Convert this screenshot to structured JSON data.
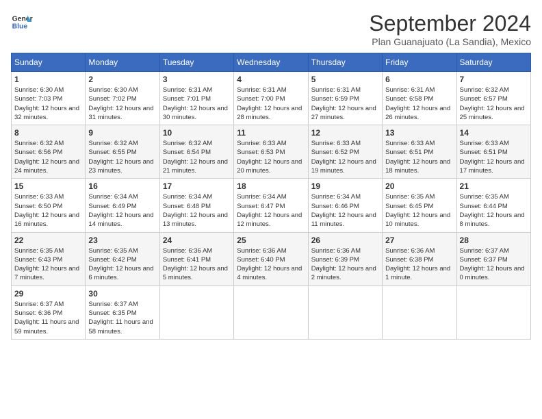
{
  "logo": {
    "line1": "General",
    "line2": "Blue"
  },
  "title": "September 2024",
  "location": "Plan Guanajuato (La Sandia), Mexico",
  "days_of_week": [
    "Sunday",
    "Monday",
    "Tuesday",
    "Wednesday",
    "Thursday",
    "Friday",
    "Saturday"
  ],
  "weeks": [
    [
      {
        "day": "1",
        "sunrise": "6:30 AM",
        "sunset": "7:03 PM",
        "daylight": "12 hours and 32 minutes."
      },
      {
        "day": "2",
        "sunrise": "6:30 AM",
        "sunset": "7:02 PM",
        "daylight": "12 hours and 31 minutes."
      },
      {
        "day": "3",
        "sunrise": "6:31 AM",
        "sunset": "7:01 PM",
        "daylight": "12 hours and 30 minutes."
      },
      {
        "day": "4",
        "sunrise": "6:31 AM",
        "sunset": "7:00 PM",
        "daylight": "12 hours and 28 minutes."
      },
      {
        "day": "5",
        "sunrise": "6:31 AM",
        "sunset": "6:59 PM",
        "daylight": "12 hours and 27 minutes."
      },
      {
        "day": "6",
        "sunrise": "6:31 AM",
        "sunset": "6:58 PM",
        "daylight": "12 hours and 26 minutes."
      },
      {
        "day": "7",
        "sunrise": "6:32 AM",
        "sunset": "6:57 PM",
        "daylight": "12 hours and 25 minutes."
      }
    ],
    [
      {
        "day": "8",
        "sunrise": "6:32 AM",
        "sunset": "6:56 PM",
        "daylight": "12 hours and 24 minutes."
      },
      {
        "day": "9",
        "sunrise": "6:32 AM",
        "sunset": "6:55 PM",
        "daylight": "12 hours and 23 minutes."
      },
      {
        "day": "10",
        "sunrise": "6:32 AM",
        "sunset": "6:54 PM",
        "daylight": "12 hours and 21 minutes."
      },
      {
        "day": "11",
        "sunrise": "6:33 AM",
        "sunset": "6:53 PM",
        "daylight": "12 hours and 20 minutes."
      },
      {
        "day": "12",
        "sunrise": "6:33 AM",
        "sunset": "6:52 PM",
        "daylight": "12 hours and 19 minutes."
      },
      {
        "day": "13",
        "sunrise": "6:33 AM",
        "sunset": "6:51 PM",
        "daylight": "12 hours and 18 minutes."
      },
      {
        "day": "14",
        "sunrise": "6:33 AM",
        "sunset": "6:51 PM",
        "daylight": "12 hours and 17 minutes."
      }
    ],
    [
      {
        "day": "15",
        "sunrise": "6:33 AM",
        "sunset": "6:50 PM",
        "daylight": "12 hours and 16 minutes."
      },
      {
        "day": "16",
        "sunrise": "6:34 AM",
        "sunset": "6:49 PM",
        "daylight": "12 hours and 14 minutes."
      },
      {
        "day": "17",
        "sunrise": "6:34 AM",
        "sunset": "6:48 PM",
        "daylight": "12 hours and 13 minutes."
      },
      {
        "day": "18",
        "sunrise": "6:34 AM",
        "sunset": "6:47 PM",
        "daylight": "12 hours and 12 minutes."
      },
      {
        "day": "19",
        "sunrise": "6:34 AM",
        "sunset": "6:46 PM",
        "daylight": "12 hours and 11 minutes."
      },
      {
        "day": "20",
        "sunrise": "6:35 AM",
        "sunset": "6:45 PM",
        "daylight": "12 hours and 10 minutes."
      },
      {
        "day": "21",
        "sunrise": "6:35 AM",
        "sunset": "6:44 PM",
        "daylight": "12 hours and 8 minutes."
      }
    ],
    [
      {
        "day": "22",
        "sunrise": "6:35 AM",
        "sunset": "6:43 PM",
        "daylight": "12 hours and 7 minutes."
      },
      {
        "day": "23",
        "sunrise": "6:35 AM",
        "sunset": "6:42 PM",
        "daylight": "12 hours and 6 minutes."
      },
      {
        "day": "24",
        "sunrise": "6:36 AM",
        "sunset": "6:41 PM",
        "daylight": "12 hours and 5 minutes."
      },
      {
        "day": "25",
        "sunrise": "6:36 AM",
        "sunset": "6:40 PM",
        "daylight": "12 hours and 4 minutes."
      },
      {
        "day": "26",
        "sunrise": "6:36 AM",
        "sunset": "6:39 PM",
        "daylight": "12 hours and 2 minutes."
      },
      {
        "day": "27",
        "sunrise": "6:36 AM",
        "sunset": "6:38 PM",
        "daylight": "12 hours and 1 minute."
      },
      {
        "day": "28",
        "sunrise": "6:37 AM",
        "sunset": "6:37 PM",
        "daylight": "12 hours and 0 minutes."
      }
    ],
    [
      {
        "day": "29",
        "sunrise": "6:37 AM",
        "sunset": "6:36 PM",
        "daylight": "11 hours and 59 minutes."
      },
      {
        "day": "30",
        "sunrise": "6:37 AM",
        "sunset": "6:35 PM",
        "daylight": "11 hours and 58 minutes."
      },
      null,
      null,
      null,
      null,
      null
    ]
  ],
  "labels": {
    "sunrise": "Sunrise: ",
    "sunset": "Sunset: ",
    "daylight": "Daylight: "
  }
}
